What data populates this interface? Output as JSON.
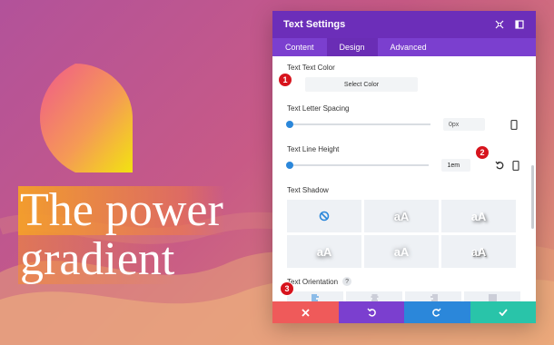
{
  "panel": {
    "title": "Text Settings",
    "tabs": [
      {
        "label": "Content"
      },
      {
        "label": "Design"
      },
      {
        "label": "Advanced"
      }
    ],
    "active_tab": "Design"
  },
  "fields": {
    "text_color": {
      "label": "Text Text Color",
      "button": "Select Color"
    },
    "letter_spacing": {
      "label": "Text Letter Spacing",
      "value": "0px",
      "slider_level": 0
    },
    "line_height": {
      "label": "Text Line Height",
      "value": "1em",
      "slider_level": 0
    },
    "text_shadow": {
      "label": "Text Shadow",
      "options": [
        "none",
        "aA",
        "aA",
        "aA",
        "aA",
        "aA"
      ]
    },
    "orientation": {
      "label": "Text Orientation",
      "help": "?"
    }
  },
  "badges": [
    "1",
    "2",
    "3"
  ],
  "headline": {
    "line1": "The power",
    "line2": "gradient"
  },
  "colors": {
    "titlebar": "#6c2eb9",
    "tabs": "#7b3fcf",
    "accent_blue": "#2b87da",
    "cancel": "#ef5a5a",
    "undo": "#7b3fcf",
    "redo": "#2b87da",
    "save": "#29c4a9",
    "badge": "#d7141d"
  }
}
